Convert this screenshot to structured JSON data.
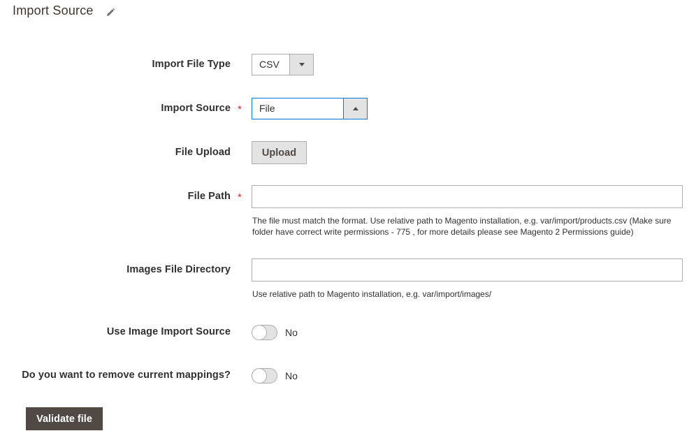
{
  "section": {
    "title": "Import Source",
    "edit_icon": "pencil-icon"
  },
  "fields": {
    "import_file_type": {
      "label": "Import File Type",
      "value": "CSV",
      "icon": "chevron-down-icon"
    },
    "import_source": {
      "label": "Import Source",
      "required_mark": "*",
      "value": "File",
      "icon": "chevron-up-icon"
    },
    "file_upload": {
      "label": "File Upload",
      "button_label": "Upload"
    },
    "file_path": {
      "label": "File Path",
      "required_mark": "*",
      "value": "",
      "placeholder": "",
      "note": "The file must match the format. Use relative path to Magento installation, e.g. var/import/products.csv (Make sure folder have correct write permissions - 775 , for more details please see Magento 2 Permissions guide)"
    },
    "images_file_directory": {
      "label": "Images File Directory",
      "value": "",
      "placeholder": "",
      "note": "Use relative path to Magento installation, e.g. var/import/images/"
    },
    "use_image_import_source": {
      "label": "Use Image Import Source",
      "state": "No"
    },
    "remove_current_mappings": {
      "label": "Do you want to remove current mappings?",
      "state": "No"
    }
  },
  "actions": {
    "validate_label": "Validate file"
  },
  "colors": {
    "required": "#e22626",
    "focus_border": "#007bdb",
    "primary_button": "#514943"
  }
}
